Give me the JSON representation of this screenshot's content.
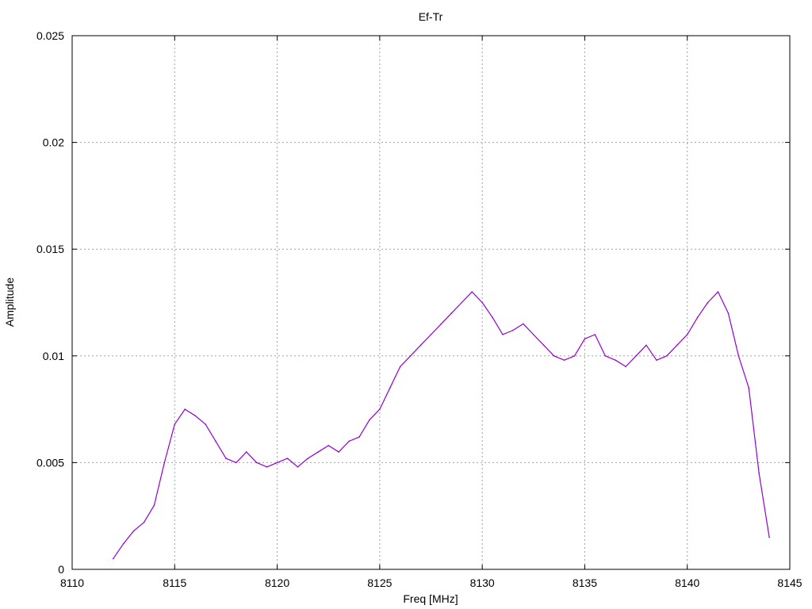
{
  "chart_data": {
    "type": "line",
    "title": "Ef-Tr",
    "xlabel": "Freq [MHz]",
    "ylabel": "Amplitude",
    "xlim": [
      8110,
      8145
    ],
    "ylim": [
      0,
      0.025
    ],
    "xticks": [
      8110,
      8115,
      8120,
      8125,
      8130,
      8135,
      8140,
      8145
    ],
    "xtick_labels": [
      "8110",
      "8115",
      "8120",
      "8125",
      "8130",
      "8135",
      "8140",
      "8145"
    ],
    "yticks": [
      0,
      0.005,
      0.01,
      0.015,
      0.02,
      0.025
    ],
    "ytick_labels": [
      "0",
      "0.005",
      "0.01",
      "0.015",
      "0.02",
      "0.025"
    ],
    "grid": true,
    "series": [
      {
        "color": "#9400d3",
        "x": [
          8112.0,
          8112.5,
          8113.0,
          8113.5,
          8114.0,
          8114.5,
          8115.0,
          8115.5,
          8116.0,
          8116.5,
          8117.0,
          8117.5,
          8118.0,
          8118.5,
          8119.0,
          8119.5,
          8120.0,
          8120.5,
          8121.0,
          8121.5,
          8122.0,
          8122.5,
          8123.0,
          8123.5,
          8124.0,
          8124.5,
          8125.0,
          8125.5,
          8126.0,
          8126.5,
          8127.0,
          8127.5,
          8128.0,
          8128.5,
          8129.0,
          8129.5,
          8130.0,
          8130.5,
          8131.0,
          8131.5,
          8132.0,
          8132.5,
          8133.0,
          8133.5,
          8134.0,
          8134.5,
          8135.0,
          8135.5,
          8136.0,
          8136.5,
          8137.0,
          8137.5,
          8138.0,
          8138.5,
          8139.0,
          8139.5,
          8140.0,
          8140.5,
          8141.0,
          8141.5,
          8142.0,
          8142.5,
          8143.0,
          8143.5,
          8144.0
        ],
        "y": [
          0.0005,
          0.0012,
          0.0018,
          0.0022,
          0.003,
          0.005,
          0.0068,
          0.0075,
          0.0072,
          0.0068,
          0.006,
          0.0052,
          0.005,
          0.0055,
          0.005,
          0.0048,
          0.005,
          0.0052,
          0.0048,
          0.0052,
          0.0055,
          0.0058,
          0.0055,
          0.006,
          0.0062,
          0.007,
          0.0075,
          0.0085,
          0.0095,
          0.01,
          0.0105,
          0.011,
          0.0115,
          0.012,
          0.0125,
          0.013,
          0.0125,
          0.0118,
          0.011,
          0.0112,
          0.0115,
          0.011,
          0.0105,
          0.01,
          0.0098,
          0.01,
          0.0108,
          0.011,
          0.01,
          0.0098,
          0.0095,
          0.01,
          0.0105,
          0.0098,
          0.01,
          0.0105,
          0.011,
          0.0118,
          0.0125,
          0.013,
          0.012,
          0.01,
          0.0085,
          0.0045,
          0.0015
        ]
      }
    ]
  }
}
